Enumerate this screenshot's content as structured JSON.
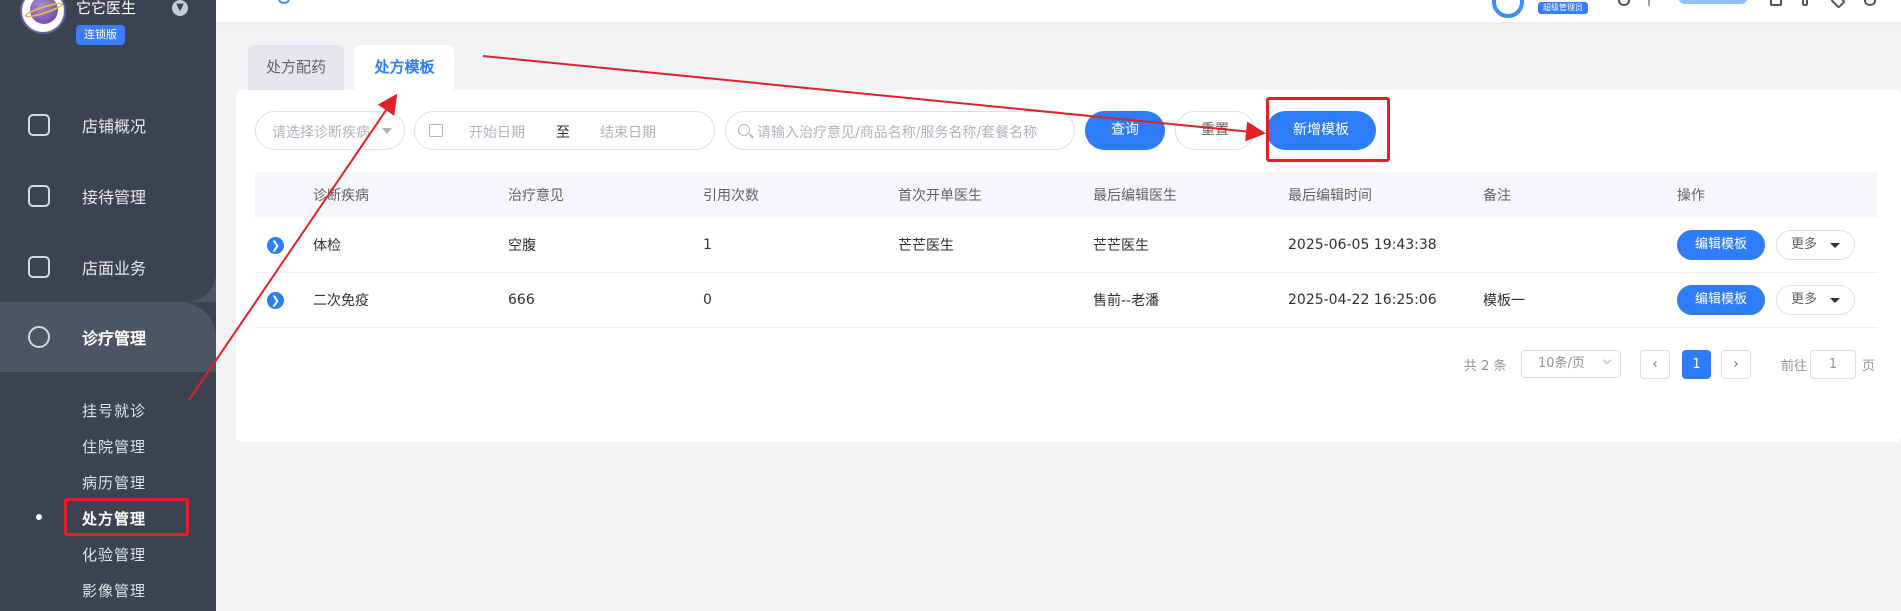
{
  "sidebar": {
    "clinic_name": "它它医生",
    "edition": "连锁版",
    "nav": [
      {
        "label": "店铺概况",
        "icon": "dashboard-icon"
      },
      {
        "label": "接待管理",
        "icon": "reception-icon"
      },
      {
        "label": "店面业务",
        "icon": "store-icon"
      },
      {
        "label": "诊疗管理",
        "icon": "medical-kit-icon"
      }
    ],
    "sub": [
      {
        "label": "挂号就诊"
      },
      {
        "label": "住院管理"
      },
      {
        "label": "病历管理"
      },
      {
        "label": "处方管理"
      },
      {
        "label": "化验管理"
      },
      {
        "label": "影像管理"
      }
    ]
  },
  "header": {
    "role_badge": "超级管理员"
  },
  "tabs": [
    {
      "label": "处方配药"
    },
    {
      "label": "处方模板"
    }
  ],
  "filters": {
    "diagnosis_placeholder": "请选择诊断疾病",
    "start_date_placeholder": "开始日期",
    "date_separator": "至",
    "end_date_placeholder": "结束日期",
    "search_placeholder": "请输入治疗意见/商品名称/服务名称/套餐名称",
    "query_label": "查询",
    "reset_label": "重置",
    "new_template_label": "新增模板"
  },
  "table": {
    "columns": [
      "诊断疾病",
      "治疗意见",
      "引用次数",
      "首次开单医生",
      "最后编辑医生",
      "最后编辑时间",
      "备注",
      "操作"
    ],
    "rows": [
      {
        "diagnosis": "体检",
        "treatment": "空腹",
        "count": "1",
        "first_doctor": "芒芒医生",
        "last_doctor": "芒芒医生",
        "last_time": "2025-06-05 19:43:38",
        "note": ""
      },
      {
        "diagnosis": "二次免疫",
        "treatment": "666",
        "count": "0",
        "first_doctor": "",
        "last_doctor": "售前--老潘",
        "last_time": "2025-04-22 16:25:06",
        "note": "模板一"
      }
    ],
    "edit_label": "编辑模板",
    "more_label": "更多"
  },
  "pagination": {
    "total": "共 2 条",
    "page_size": "10条/页",
    "current": "1",
    "goto_label": "前往",
    "goto_value": "1",
    "page_suffix": "页"
  },
  "colors": {
    "primary": "#2e7cf6",
    "sidebar": "#3b4350",
    "annotation": "#e0212a"
  }
}
